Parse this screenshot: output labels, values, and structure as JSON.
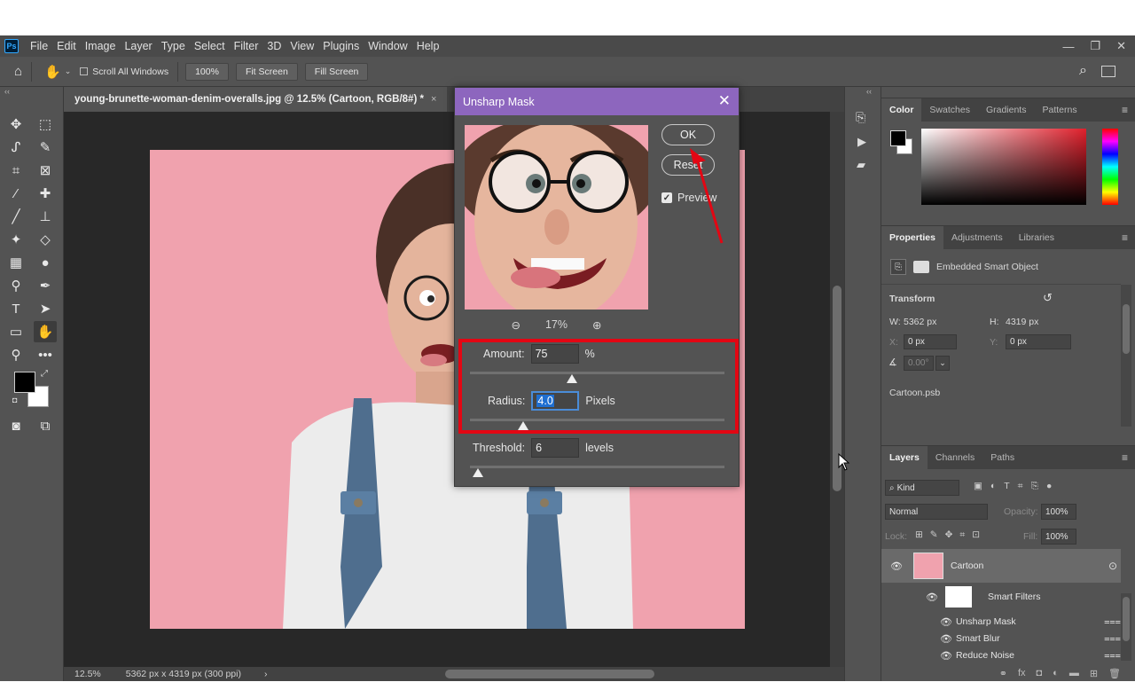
{
  "menu": {
    "logo": "Ps",
    "items": [
      "File",
      "Edit",
      "Image",
      "Layer",
      "Type",
      "Select",
      "Filter",
      "3D",
      "View",
      "Plugins",
      "Window",
      "Help"
    ],
    "window_controls": [
      "—",
      "❐",
      "✕"
    ]
  },
  "options": {
    "scroll_all_windows": "Scroll All Windows",
    "zoom_100": "100%",
    "fit_screen": "Fit Screen",
    "fill_screen": "Fill Screen"
  },
  "document": {
    "tab_title": "young-brunette-woman-denim-overalls.jpg @ 12.5% (Cartoon, RGB/8#) *",
    "tab_close": "×",
    "status_zoom": "12.5%",
    "status_info": "5362 px x 4319 px (300 ppi)",
    "status_arrow": "›"
  },
  "dialog": {
    "title": "Unsharp Mask",
    "close": "✕",
    "ok_label": "OK",
    "reset_label": "Reset",
    "preview_label": "Preview",
    "preview_checked": true,
    "zoom_level": "17%",
    "amount_label": "Amount:",
    "amount_value": "75",
    "amount_unit": "%",
    "radius_label": "Radius:",
    "radius_value": "4.0",
    "radius_unit": "Pixels",
    "threshold_label": "Threshold:",
    "threshold_value": "6",
    "threshold_unit": "levels",
    "amount_slider_fraction": 0.4,
    "radius_slider_fraction": 0.21,
    "threshold_slider_fraction": 0.03
  },
  "color_panel": {
    "tabs": [
      "Color",
      "Swatches",
      "Gradients",
      "Patterns"
    ],
    "active_tab": "Color",
    "foreground": "#000000",
    "background": "#ffffff"
  },
  "properties_panel": {
    "tabs": [
      "Properties",
      "Adjustments",
      "Libraries"
    ],
    "active_tab": "Properties",
    "object_type": "Embedded Smart Object",
    "transform_label": "Transform",
    "w_label": "W:",
    "w_value": "5362 px",
    "h_label": "H:",
    "h_value": "4319 px",
    "x_label": "X:",
    "x_value": "0 px",
    "y_label": "Y:",
    "y_value": "0 px",
    "angle_value": "0.00°",
    "file_name": "Cartoon.psb"
  },
  "layers_panel": {
    "tabs": [
      "Layers",
      "Channels",
      "Paths"
    ],
    "active_tab": "Layers",
    "kind_label": "Kind",
    "blend_mode": "Normal",
    "opacity_label": "Opacity:",
    "opacity_value": "100%",
    "lock_label": "Lock:",
    "fill_label": "Fill:",
    "fill_value": "100%",
    "layer_name": "Cartoon",
    "smart_filters_label": "Smart Filters",
    "filters": [
      "Unsharp Mask",
      "Smart Blur",
      "Reduce Noise"
    ]
  }
}
